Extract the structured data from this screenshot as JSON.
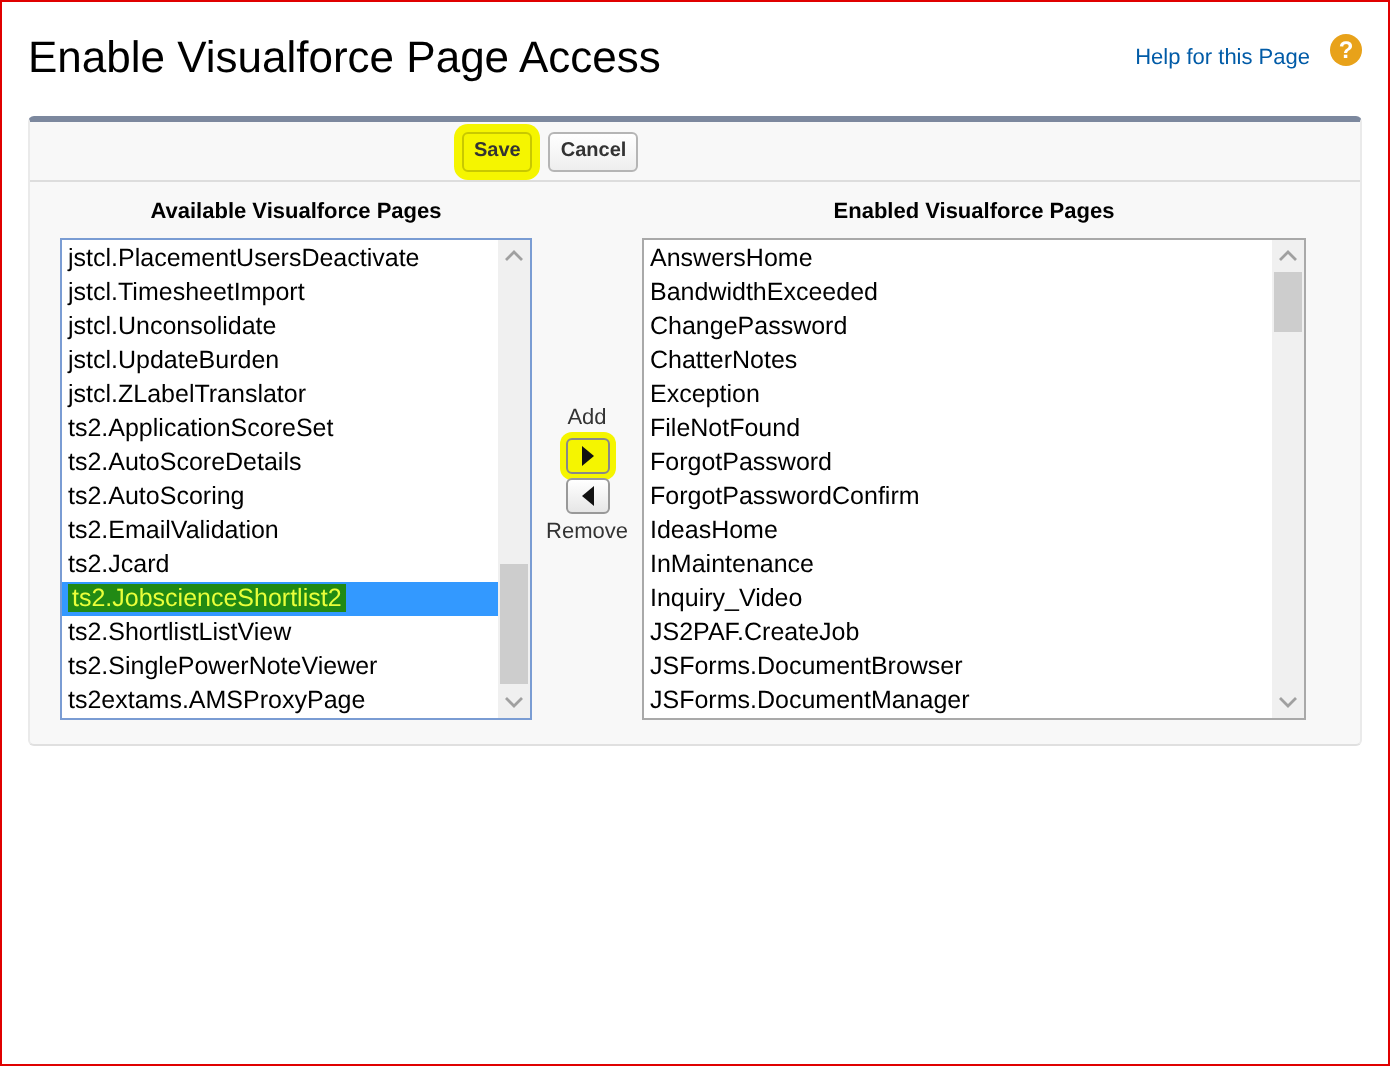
{
  "page": {
    "title": "Enable Visualforce Page Access",
    "help_link": "Help for this Page",
    "help_icon": "?"
  },
  "toolbar": {
    "buttons": [
      {
        "label": "Save",
        "highlighted": true
      },
      {
        "label": "Cancel",
        "highlighted": false
      }
    ]
  },
  "available": {
    "label": "Available Visualforce Pages",
    "items": [
      {
        "label": "jstcl.PlacementUsersDeactivate",
        "selected": false,
        "highlighted": false
      },
      {
        "label": "jstcl.TimesheetImport",
        "selected": false,
        "highlighted": false
      },
      {
        "label": "jstcl.Unconsolidate",
        "selected": false,
        "highlighted": false
      },
      {
        "label": "jstcl.UpdateBurden",
        "selected": false,
        "highlighted": false
      },
      {
        "label": "jstcl.ZLabelTranslator",
        "selected": false,
        "highlighted": false
      },
      {
        "label": "ts2.ApplicationScoreSet",
        "selected": false,
        "highlighted": false
      },
      {
        "label": "ts2.AutoScoreDetails",
        "selected": false,
        "highlighted": false
      },
      {
        "label": "ts2.AutoScoring",
        "selected": false,
        "highlighted": false
      },
      {
        "label": "ts2.EmailValidation",
        "selected": false,
        "highlighted": false
      },
      {
        "label": "ts2.Jcard",
        "selected": false,
        "highlighted": false
      },
      {
        "label": "ts2.JobscienceShortlist2",
        "selected": true,
        "highlighted": true
      },
      {
        "label": "ts2.ShortlistListView",
        "selected": false,
        "highlighted": false
      },
      {
        "label": "ts2.SinglePowerNoteViewer",
        "selected": false,
        "highlighted": false
      },
      {
        "label": "ts2extams.AMSProxyPage",
        "selected": false,
        "highlighted": false
      }
    ]
  },
  "move": {
    "add_label": "Add",
    "add_highlighted": true,
    "remove_label": "Remove",
    "remove_highlighted": false
  },
  "enabled": {
    "label": "Enabled Visualforce Pages",
    "items": [
      {
        "label": "AnswersHome",
        "selected": false
      },
      {
        "label": "BandwidthExceeded",
        "selected": false
      },
      {
        "label": "ChangePassword",
        "selected": false
      },
      {
        "label": "ChatterNotes",
        "selected": false
      },
      {
        "label": "Exception",
        "selected": false
      },
      {
        "label": "FileNotFound",
        "selected": false
      },
      {
        "label": "ForgotPassword",
        "selected": false
      },
      {
        "label": "ForgotPasswordConfirm",
        "selected": false
      },
      {
        "label": "IdeasHome",
        "selected": false
      },
      {
        "label": "InMaintenance",
        "selected": false
      },
      {
        "label": "Inquiry_Video",
        "selected": false
      },
      {
        "label": "JS2PAF.CreateJob",
        "selected": false
      },
      {
        "label": "JSForms.DocumentBrowser",
        "selected": false
      },
      {
        "label": "JSForms.DocumentManager",
        "selected": false
      }
    ]
  }
}
